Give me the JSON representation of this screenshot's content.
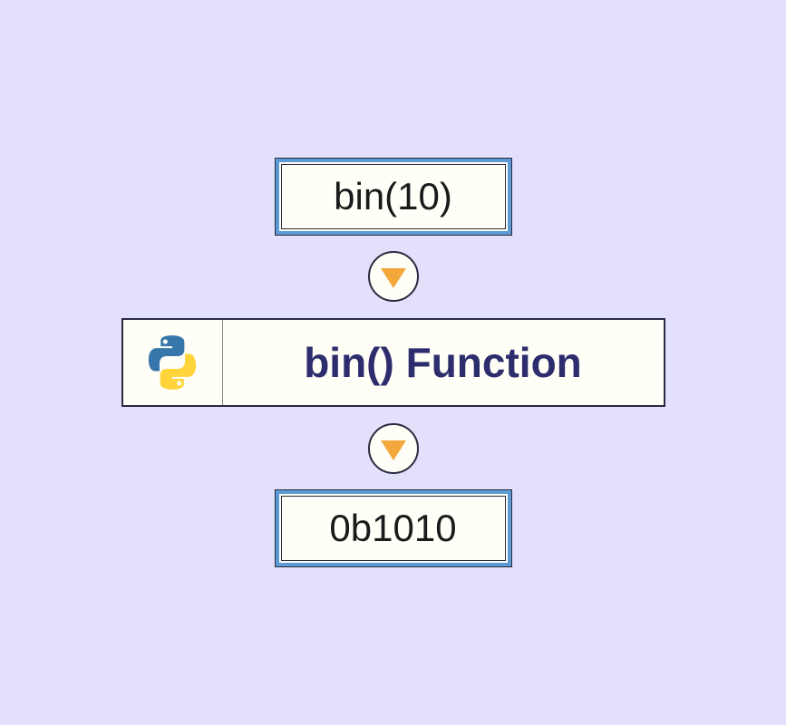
{
  "input_value": "bin(10)",
  "function_label": "bin() Function",
  "output_value": "0b1010"
}
